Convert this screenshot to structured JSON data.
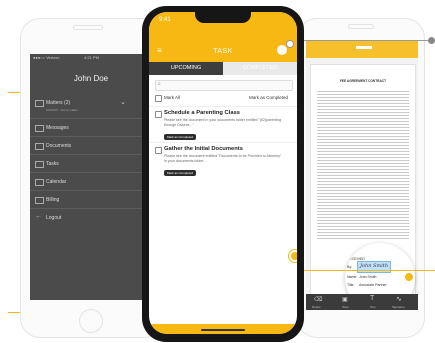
{
  "left_phone": {
    "status": {
      "carrier": "●●●○○ Verizon",
      "time": "4:21 PM"
    },
    "user_name": "John Doe",
    "menu": [
      {
        "label": "Matters (2)",
        "sub": "XXXXXX - Some matter",
        "icon": "briefcase-icon"
      },
      {
        "label": "Messages",
        "icon": "message-icon"
      },
      {
        "label": "Documents",
        "icon": "document-icon"
      },
      {
        "label": "Tasks",
        "icon": "tasks-icon"
      },
      {
        "label": "Calendar",
        "icon": "calendar-icon"
      },
      {
        "label": "Billing",
        "icon": "billing-icon"
      },
      {
        "label": "Logout",
        "icon": "logout-icon"
      }
    ]
  },
  "center_phone": {
    "time": "9:41",
    "title": "TASK",
    "tabs": [
      "UPCOMING",
      "COMPLETED"
    ],
    "mark_all": "Mark All",
    "mark_completed": "Mark as Completed",
    "tasks": [
      {
        "title": "Schedule a Parenting Class",
        "desc": "Please see the document in your documents folder entitled \"(02)parenting through Divorce...\"",
        "badge": "Mark as Completed"
      },
      {
        "title": "Gather the Initial Documents",
        "desc": "Please see the document entitled \"Documents to be Provided to Attorney\" in your documents folder...",
        "badge": "Mark as Completed"
      }
    ]
  },
  "right_phone": {
    "doc_title": "FEE AGREEMENT CONTRACT",
    "signature_fields": [
      {
        "label": "RECEIVED",
        "value": ""
      },
      {
        "label": "By:",
        "value": "John Smith"
      },
      {
        "label": "Name:",
        "value": "John Smith"
      },
      {
        "label": "Title:",
        "value": "Associate Partner"
      }
    ],
    "toolbar": [
      "Delete",
      "Save",
      "Text",
      "Signature"
    ]
  },
  "colors": {
    "accent": "#f8b814",
    "dark": "#3d3d3d"
  }
}
